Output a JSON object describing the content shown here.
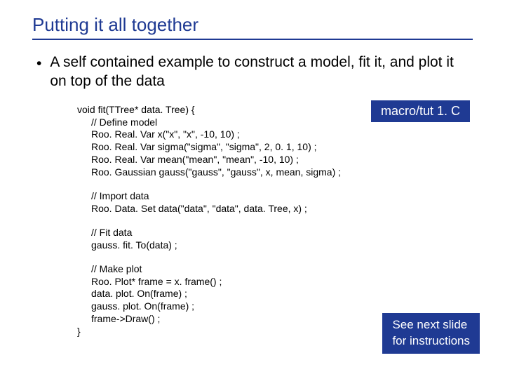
{
  "title": "Putting it all together",
  "bullet": "A self contained example to construct a model, fit it, and plot it on top of the data",
  "code": {
    "fn_open": "void fit(TTree* data. Tree) {",
    "s1_comment": "// Define model",
    "s1_l1": "Roo. Real. Var x(\"x\", \"x\", -10, 10) ;",
    "s1_l2": "Roo. Real. Var sigma(\"sigma\", \"sigma\", 2, 0. 1, 10) ;",
    "s1_l3": "Roo. Real. Var mean(\"mean\", \"mean\", -10, 10) ;",
    "s1_l4": "Roo. Gaussian gauss(\"gauss\", \"gauss\", x, mean, sigma) ;",
    "s2_comment": "// Import data",
    "s2_l1": "Roo. Data. Set data(\"data\", \"data\", data. Tree, x) ;",
    "s3_comment": "// Fit data",
    "s3_l1": "gauss. fit. To(data) ;",
    "s4_comment": "// Make plot",
    "s4_l1": "Roo. Plot* frame = x. frame() ;",
    "s4_l2": "data. plot. On(frame) ;",
    "s4_l3": "gauss. plot. On(frame) ;",
    "s4_l4": "frame->Draw() ;",
    "fn_close": "}"
  },
  "tag_macro": "macro/tut 1. C",
  "tag_note_l1": "See next slide",
  "tag_note_l2": "for instructions"
}
